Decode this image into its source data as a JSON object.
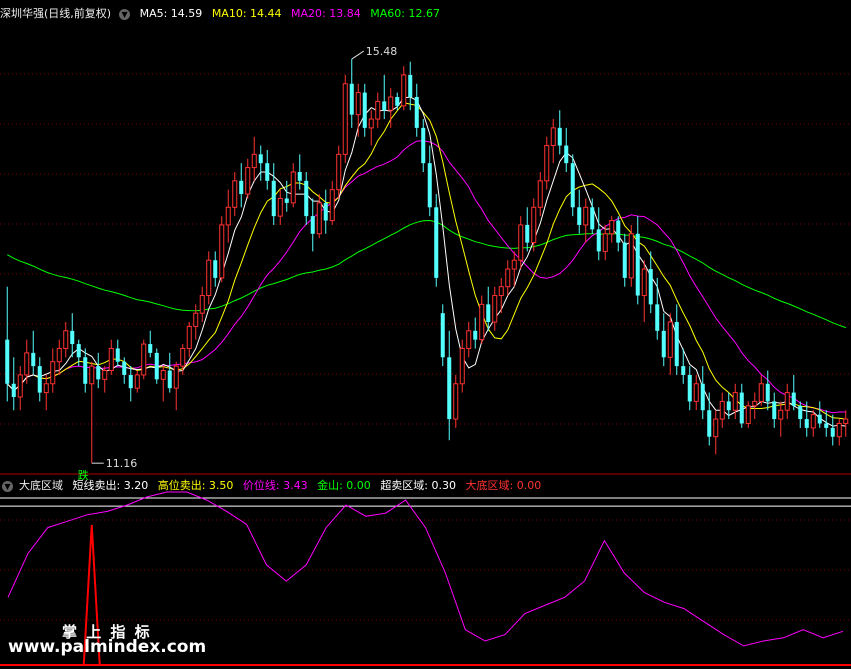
{
  "main_header": {
    "title": "深圳华强(日线,前复权)",
    "ma5": "MA5: 14.59",
    "ma10": "MA10: 14.44",
    "ma20": "MA20: 13.84",
    "ma60": "MA60: 12.67"
  },
  "indicator_header": {
    "name": "大底区域",
    "short_sell": "短线卖出: 3.20",
    "high_sell": "高位卖出: 3.50",
    "price_line": "价位线: 3.43",
    "gold_mountain": "金山: 0.00",
    "oversold_zone": "超卖区域: 0.30",
    "bottom_zone": "大底区域: 0.00"
  },
  "annotations": {
    "high_label": "15.48",
    "low_label": "11.16",
    "signal_label": "跌"
  },
  "watermark": {
    "line1": "掌 上 指 标",
    "line2": "www.palmindex.com"
  },
  "colors": {
    "up": "#ff3232",
    "down": "#54ffff",
    "ma5": "#ffffff",
    "ma10": "#ffff00",
    "ma20": "#ff00ff",
    "ma60": "#00ff00",
    "indicator": "#ff00ff",
    "bottom_zone": "#ff0000",
    "grid": "#800000",
    "ref_line": "#ffffff"
  },
  "chart_data": [
    {
      "type": "candlestick",
      "series_note": "daily OHLC estimated from the chart",
      "candles": [
        [
          12.3,
          12.9,
          11.6,
          11.8
        ],
        [
          11.8,
          12.1,
          11.5,
          11.65
        ],
        [
          11.65,
          12.0,
          11.5,
          11.9
        ],
        [
          11.9,
          12.3,
          11.8,
          12.15
        ],
        [
          12.15,
          12.4,
          11.9,
          12.0
        ],
        [
          12.0,
          12.1,
          11.6,
          11.7
        ],
        [
          11.7,
          11.9,
          11.5,
          11.8
        ],
        [
          11.8,
          12.2,
          11.7,
          12.05
        ],
        [
          12.05,
          12.3,
          11.9,
          12.2
        ],
        [
          12.2,
          12.5,
          12.1,
          12.4
        ],
        [
          12.4,
          12.6,
          12.1,
          12.25
        ],
        [
          12.25,
          12.3,
          12.0,
          12.1
        ],
        [
          12.1,
          12.2,
          11.7,
          11.8
        ],
        [
          11.8,
          12.05,
          10.9,
          12.0
        ],
        [
          12.0,
          12.15,
          11.75,
          11.85
        ],
        [
          11.85,
          12.0,
          11.7,
          11.95
        ],
        [
          11.95,
          12.3,
          11.9,
          12.2
        ],
        [
          12.2,
          12.3,
          12.0,
          12.05
        ],
        [
          12.05,
          12.1,
          11.8,
          11.9
        ],
        [
          11.9,
          12.0,
          11.6,
          11.75
        ],
        [
          11.75,
          11.95,
          11.7,
          11.9
        ],
        [
          11.9,
          12.3,
          11.85,
          12.25
        ],
        [
          12.25,
          12.4,
          12.1,
          12.15
        ],
        [
          12.15,
          12.2,
          11.8,
          11.85
        ],
        [
          11.85,
          12.0,
          11.6,
          11.95
        ],
        [
          11.95,
          12.15,
          11.7,
          11.75
        ],
        [
          11.75,
          12.05,
          11.5,
          12.0
        ],
        [
          12.0,
          12.25,
          11.9,
          12.2
        ],
        [
          12.2,
          12.5,
          12.1,
          12.45
        ],
        [
          12.45,
          12.7,
          12.3,
          12.6
        ],
        [
          12.6,
          12.9,
          12.5,
          12.8
        ],
        [
          12.8,
          13.3,
          12.7,
          13.2
        ],
        [
          13.2,
          13.3,
          12.9,
          13.0
        ],
        [
          13.0,
          13.7,
          12.95,
          13.6
        ],
        [
          13.6,
          14.0,
          13.4,
          13.8
        ],
        [
          13.8,
          14.2,
          13.7,
          14.1
        ],
        [
          14.1,
          14.3,
          13.8,
          13.95
        ],
        [
          13.95,
          14.35,
          13.9,
          14.25
        ],
        [
          14.25,
          14.6,
          14.1,
          14.4
        ],
        [
          14.4,
          14.5,
          14.1,
          14.3
        ],
        [
          14.3,
          14.45,
          14.0,
          14.1
        ],
        [
          14.1,
          14.3,
          13.6,
          13.7
        ],
        [
          13.7,
          14.0,
          13.6,
          13.9
        ],
        [
          13.9,
          14.1,
          13.75,
          13.85
        ],
        [
          13.85,
          14.3,
          13.8,
          14.2
        ],
        [
          14.2,
          14.4,
          14.0,
          14.1
        ],
        [
          14.1,
          14.2,
          13.6,
          13.7
        ],
        [
          13.7,
          13.9,
          13.3,
          13.5
        ],
        [
          13.5,
          13.95,
          13.45,
          13.85
        ],
        [
          13.85,
          14.0,
          13.5,
          13.65
        ],
        [
          13.65,
          14.1,
          13.6,
          14.0
        ],
        [
          14.0,
          14.5,
          13.9,
          14.4
        ],
        [
          14.4,
          15.3,
          14.3,
          15.2
        ],
        [
          15.2,
          15.48,
          14.7,
          14.85
        ],
        [
          14.85,
          15.2,
          14.6,
          15.1
        ],
        [
          15.1,
          15.2,
          14.6,
          14.7
        ],
        [
          14.7,
          14.9,
          14.5,
          14.8
        ],
        [
          14.8,
          15.1,
          14.7,
          15.0
        ],
        [
          15.0,
          15.3,
          14.8,
          14.9
        ],
        [
          14.9,
          15.15,
          14.7,
          15.05
        ],
        [
          15.05,
          15.1,
          14.9,
          14.95
        ],
        [
          14.95,
          15.4,
          14.9,
          15.3
        ],
        [
          15.3,
          15.45,
          14.9,
          15.05
        ],
        [
          15.05,
          15.2,
          14.6,
          14.7
        ],
        [
          14.7,
          14.8,
          14.2,
          14.3
        ],
        [
          14.3,
          14.5,
          13.7,
          13.8
        ],
        [
          13.8,
          13.95,
          12.9,
          13.0
        ],
        [
          12.6,
          12.7,
          12.0,
          12.1
        ],
        [
          12.1,
          12.4,
          11.16,
          11.4
        ],
        [
          11.4,
          11.9,
          11.3,
          11.8
        ],
        [
          11.8,
          12.3,
          11.7,
          12.2
        ],
        [
          12.2,
          12.5,
          12.1,
          12.4
        ],
        [
          12.4,
          12.55,
          12.2,
          12.3
        ],
        [
          12.3,
          12.8,
          12.25,
          12.7
        ],
        [
          12.7,
          12.9,
          12.4,
          12.5
        ],
        [
          12.5,
          12.9,
          12.4,
          12.8
        ],
        [
          12.8,
          13.0,
          12.6,
          12.9
        ],
        [
          12.9,
          13.2,
          12.8,
          13.1
        ],
        [
          13.1,
          13.3,
          12.9,
          13.2
        ],
        [
          13.2,
          13.7,
          13.1,
          13.6
        ],
        [
          13.6,
          13.8,
          13.3,
          13.4
        ],
        [
          13.4,
          13.9,
          13.3,
          13.8
        ],
        [
          13.8,
          14.2,
          13.7,
          14.1
        ],
        [
          14.1,
          14.6,
          14.0,
          14.5
        ],
        [
          14.5,
          14.8,
          14.3,
          14.7
        ],
        [
          14.7,
          14.9,
          14.4,
          14.5
        ],
        [
          14.5,
          14.7,
          14.2,
          14.3
        ],
        [
          14.3,
          14.4,
          13.7,
          13.8
        ],
        [
          13.8,
          14.0,
          13.5,
          13.6
        ],
        [
          13.6,
          13.9,
          13.4,
          13.8
        ],
        [
          13.8,
          13.9,
          13.5,
          13.55
        ],
        [
          13.55,
          13.8,
          13.2,
          13.3
        ],
        [
          13.3,
          13.6,
          13.2,
          13.5
        ],
        [
          13.5,
          13.7,
          13.4,
          13.65
        ],
        [
          13.65,
          13.7,
          13.3,
          13.4
        ],
        [
          13.4,
          13.5,
          12.9,
          13.0
        ],
        [
          13.0,
          13.6,
          12.9,
          13.5
        ],
        [
          13.5,
          13.7,
          12.7,
          12.8
        ],
        [
          12.8,
          13.2,
          12.5,
          13.1
        ],
        [
          13.1,
          13.3,
          12.6,
          12.7
        ],
        [
          12.7,
          13.0,
          12.3,
          12.4
        ],
        [
          12.4,
          12.6,
          12.0,
          12.1
        ],
        [
          12.1,
          12.6,
          11.9,
          12.5
        ],
        [
          12.5,
          12.7,
          11.9,
          12.0
        ],
        [
          12.0,
          12.2,
          11.8,
          11.9
        ],
        [
          11.9,
          12.0,
          11.5,
          11.6
        ],
        [
          11.6,
          11.9,
          11.5,
          11.8
        ],
        [
          11.8,
          12.0,
          11.4,
          11.5
        ],
        [
          11.5,
          11.7,
          11.1,
          11.2
        ],
        [
          11.2,
          11.5,
          11.0,
          11.4
        ],
        [
          11.4,
          11.7,
          11.3,
          11.6
        ],
        [
          11.6,
          11.7,
          11.4,
          11.5
        ],
        [
          11.5,
          11.8,
          11.4,
          11.7
        ],
        [
          11.7,
          11.8,
          11.3,
          11.35
        ],
        [
          11.35,
          11.6,
          11.3,
          11.55
        ],
        [
          11.55,
          11.7,
          11.4,
          11.6
        ],
        [
          11.6,
          11.9,
          11.55,
          11.8
        ],
        [
          11.8,
          11.95,
          11.5,
          11.6
        ],
        [
          11.6,
          11.7,
          11.3,
          11.4
        ],
        [
          11.4,
          11.6,
          11.2,
          11.5
        ],
        [
          11.5,
          11.8,
          11.4,
          11.7
        ],
        [
          11.7,
          11.9,
          11.5,
          11.55
        ],
        [
          11.55,
          11.6,
          11.3,
          11.4
        ],
        [
          11.4,
          11.6,
          11.2,
          11.3
        ],
        [
          11.3,
          11.5,
          11.2,
          11.45
        ],
        [
          11.45,
          11.6,
          11.3,
          11.35
        ],
        [
          11.35,
          11.5,
          11.2,
          11.3
        ],
        [
          11.3,
          11.45,
          11.1,
          11.2
        ],
        [
          11.2,
          11.4,
          11.1,
          11.35
        ],
        [
          11.35,
          11.5,
          11.2,
          11.4
        ]
      ],
      "ma60_start": 13.3,
      "y_range": [
        10.8,
        15.9
      ]
    },
    {
      "type": "line",
      "series": [
        {
          "name": "大底区域",
          "values": [
            0.35,
            0.62,
            0.78,
            0.82,
            0.86,
            0.88,
            0.92,
            0.97,
            1.0,
            1.0,
            0.95,
            0.88,
            0.8,
            0.55,
            0.45,
            0.55,
            0.78,
            0.92,
            0.85,
            0.87,
            0.95,
            0.78,
            0.5,
            0.15,
            0.08,
            0.12,
            0.25,
            0.3,
            0.35,
            0.45,
            0.7,
            0.5,
            0.38,
            0.32,
            0.28,
            0.2,
            0.12,
            0.05,
            0.08,
            0.1,
            0.15,
            0.1,
            0.14
          ]
        }
      ],
      "bottom_zone_spike_index": 24,
      "reference_lines": [
        1.0,
        0.95
      ]
    }
  ]
}
